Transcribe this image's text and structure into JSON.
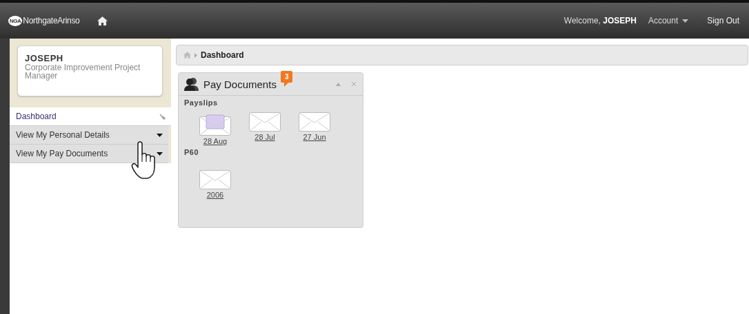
{
  "header": {
    "logo_badge": "NGA",
    "logo_text": "NorthgateArinso",
    "welcome": "Welcome, **JOSEPH**",
    "account": "Account",
    "sign_out": "Sign Out"
  },
  "profile": {
    "name": "JOSEPH",
    "role": "Corporate Improvement Project Manager"
  },
  "sidebar": {
    "items": [
      {
        "label": "Dashboard",
        "selected": true,
        "kind": "pinned"
      },
      {
        "label": "View My Personal Details",
        "selected": false,
        "kind": "dropdown"
      },
      {
        "label": "View My Pay Documents",
        "selected": false,
        "kind": "dropdown"
      }
    ]
  },
  "breadcrumb": {
    "items": [
      "Dashboard"
    ]
  },
  "widget": {
    "title": "Pay Documents",
    "badge": "3",
    "sections": [
      {
        "heading": "Payslips",
        "documents": [
          {
            "label": "28 Aug",
            "opened": true
          },
          {
            "label": "28 Jul",
            "opened": false
          },
          {
            "label": "27 Jun",
            "opened": false
          }
        ]
      },
      {
        "heading": "P60",
        "documents": [
          {
            "label": "2006",
            "opened": false
          }
        ]
      }
    ]
  }
}
